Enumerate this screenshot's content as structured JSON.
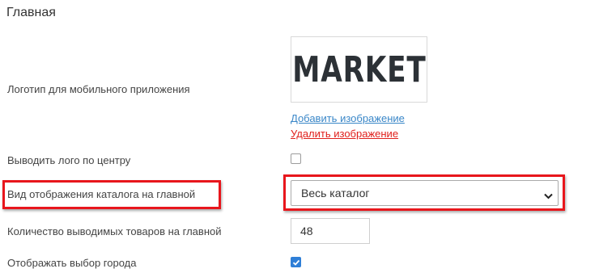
{
  "section": {
    "title": "Главная"
  },
  "logo": {
    "label": "Логотип для мобильного приложения",
    "image_text": "MARKET",
    "add_link": "Добавить изображение",
    "delete_link": "Удалить изображение"
  },
  "center_logo": {
    "label": "Выводить лого по центру",
    "checked": false
  },
  "catalog_view": {
    "label": "Вид отображения каталога на главной",
    "selected": "Весь каталог",
    "highlight_color": "#e8161c"
  },
  "products_count": {
    "label": "Количество выводимых товаров на главной",
    "value": "48"
  },
  "city_select": {
    "label": "Отображать выбор города",
    "checked": true
  },
  "colors": {
    "link": "#3a87c8",
    "danger": "#e0201c",
    "accent": "#2f7fd7"
  }
}
